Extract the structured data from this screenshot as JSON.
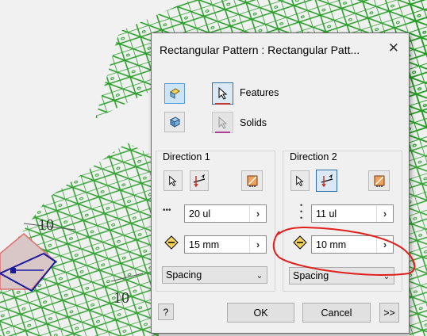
{
  "dialog": {
    "title": "Rectangular Pattern : Rectangular Patt...",
    "close_symbol": "✕",
    "features_label": "Features",
    "solids_label": "Solids",
    "direction1": {
      "title": "Direction 1",
      "count": "20 ul",
      "spacing": "15 mm",
      "method": "Spacing"
    },
    "direction2": {
      "title": "Direction 2",
      "count": "11 ul",
      "spacing": "10 mm",
      "method": "Spacing"
    },
    "help_label": "?",
    "ok_label": "OK",
    "cancel_label": "Cancel",
    "more_label": ">>"
  },
  "viewport": {
    "dimension_1": "10",
    "dimension_2": "10"
  },
  "colors": {
    "mesh_green": "#1e9a1e",
    "annotation_red": "#e0201c",
    "accent_blue": "#2f6ea5"
  }
}
